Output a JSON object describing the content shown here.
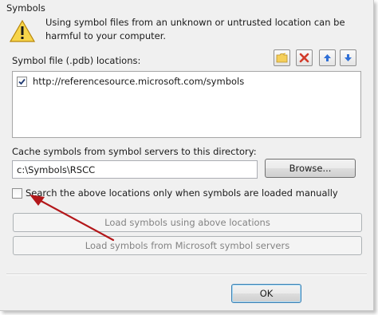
{
  "group": {
    "title": "Symbols"
  },
  "warning": {
    "icon": "warning-icon",
    "text": "Using symbol files from an unknown or untrusted location can be harmful to your computer."
  },
  "locations": {
    "label": "Symbol file (.pdb) locations:",
    "toolbar": [
      {
        "name": "new-folder-button",
        "icon": "folder-add-icon"
      },
      {
        "name": "delete-button",
        "icon": "delete-x-icon"
      },
      {
        "name": "move-up-button",
        "icon": "arrow-up-icon"
      },
      {
        "name": "move-down-button",
        "icon": "arrow-down-icon"
      }
    ],
    "items": [
      {
        "checked": true,
        "url": "http://referencesource.microsoft.com/symbols"
      }
    ]
  },
  "cache": {
    "label": "Cache symbols from symbol servers to this directory:",
    "value": "c:\\Symbols\\RSCC",
    "browse_label": "Browse..."
  },
  "manual_only": {
    "checked": false,
    "label": "Search the above locations only when symbols are loaded manually"
  },
  "actions": {
    "load_above": "Load symbols using above locations",
    "load_ms": "Load symbols from Microsoft symbol servers"
  },
  "footer": {
    "ok_label": "OK"
  },
  "colors": {
    "annotation_arrow": "#b3171a",
    "arrow_up_down": "#2f6fd6",
    "delete_x": "#d23b2b"
  }
}
